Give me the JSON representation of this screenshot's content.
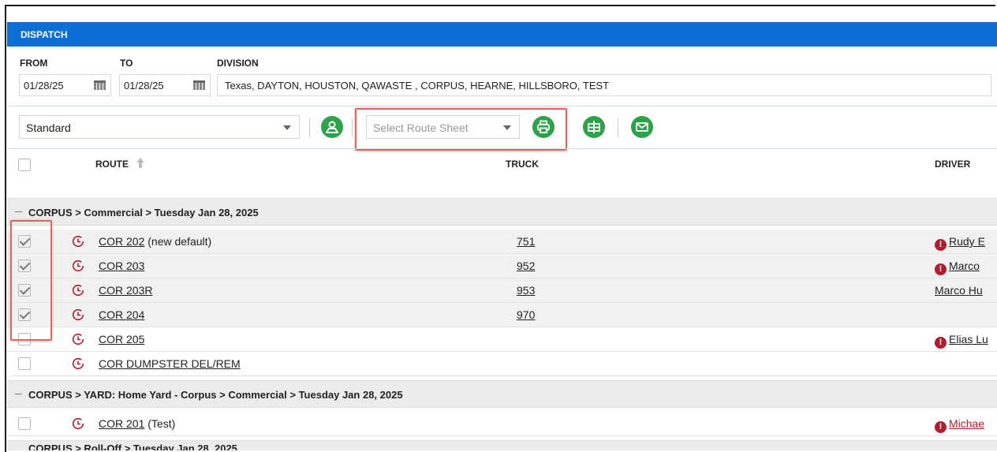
{
  "header": {
    "title": "DISPATCH"
  },
  "filters": {
    "from_label": "FROM",
    "to_label": "TO",
    "division_label": "DIVISION",
    "from_value": "01/28/25",
    "to_value": "01/28/25",
    "division_value": "Texas, DAYTON, HOUSTON, QAWASTE , CORPUS, HEARNE, HILLSBORO, TEST"
  },
  "toolbar": {
    "view_select": "Standard",
    "route_sheet_placeholder": "Select Route Sheet",
    "icons": [
      "map-pin-person-icon",
      "print-icon",
      "split-icon",
      "email-icon"
    ]
  },
  "columns": {
    "route": "ROUTE",
    "truck": "TRUCK",
    "driver": "DRIVER"
  },
  "groups": [
    {
      "label": "CORPUS > Commercial > Tuesday Jan 28, 2025"
    },
    {
      "label": "CORPUS > YARD: Home Yard - Corpus > Commercial > Tuesday Jan 28, 2025"
    },
    {
      "label": "CORPUS > Roll-Off > Tuesday Jan 28, 2025"
    }
  ],
  "rows": [
    {
      "route": "COR 202",
      "suffix": " (new default)",
      "truck": "751",
      "driver": "Rudy E",
      "alert": "!",
      "checked": true
    },
    {
      "route": "COR 203",
      "suffix": "",
      "truck": "952",
      "driver": "Marco",
      "alert": "!",
      "checked": true
    },
    {
      "route": "COR 203R",
      "suffix": "",
      "truck": "953",
      "driver": "Marco Hu",
      "alert": "",
      "checked": true
    },
    {
      "route": "COR 204",
      "suffix": "",
      "truck": "970",
      "driver": "",
      "alert": "",
      "checked": true
    },
    {
      "route": "COR 205",
      "suffix": "",
      "truck": "",
      "driver": "Elias Lu",
      "alert": "!",
      "checked": false
    },
    {
      "route": "COR DUMPSTER DEL/REM",
      "suffix": "",
      "truck": "",
      "driver": "",
      "alert": "",
      "checked": false
    },
    {
      "route": "COR 201",
      "suffix": " (Test)",
      "truck": "",
      "driver": "Michae",
      "alert": "!",
      "checked": false
    }
  ],
  "colors": {
    "header_blue": "#0d6fd6",
    "action_green": "#2ca24a",
    "alert_red": "#b01e2e",
    "highlight_red": "#e2655c"
  }
}
